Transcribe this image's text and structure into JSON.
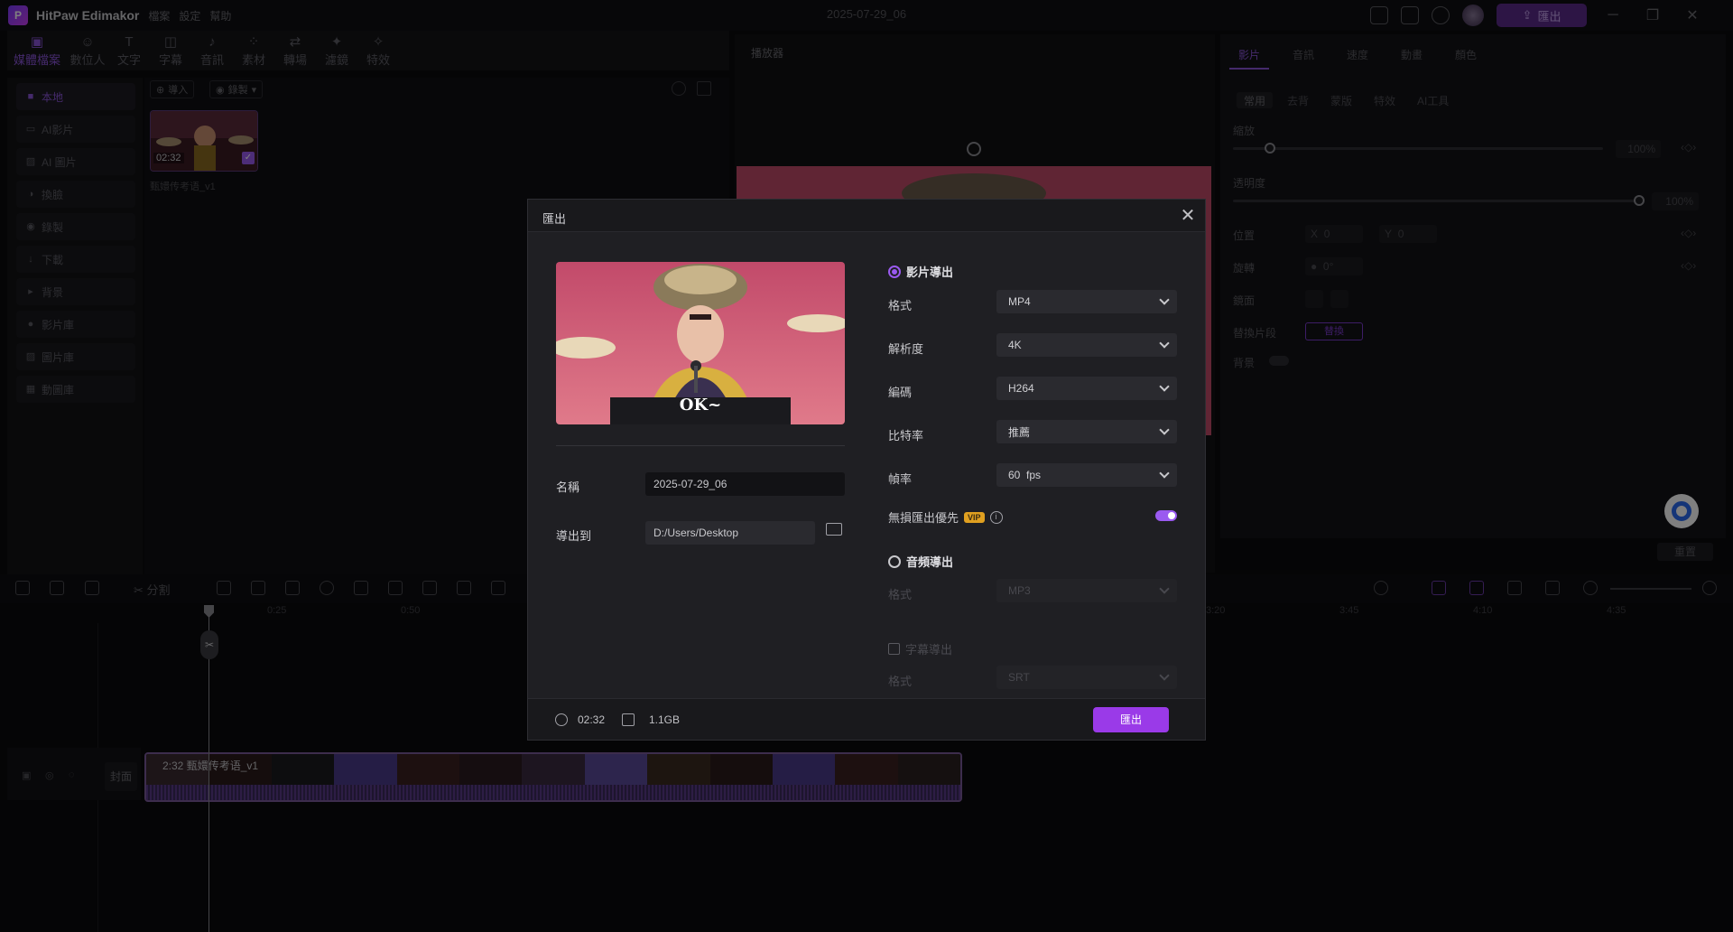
{
  "app": {
    "name": "HitPaw Edimakor",
    "window_title": "2025-07-29_06",
    "menus": [
      "檔案",
      "設定",
      "幫助"
    ],
    "top_export_label": "匯出"
  },
  "toolbar": {
    "tools": [
      "媒體檔案",
      "數位人",
      "文字",
      "字幕",
      "音訊",
      "素材",
      "轉場",
      "濾鏡",
      "特效"
    ]
  },
  "sidebar": {
    "items": [
      "本地",
      "AI影片",
      "AI 圖片",
      "換臉",
      "錄製",
      "下載",
      "背景",
      "影片庫",
      "圖片庫",
      "動圖庫"
    ]
  },
  "media": {
    "import_label": "導入",
    "record_label": "錄製",
    "clip_name": "甄嬛传考语_v1",
    "clip_duration": "02:32"
  },
  "player": {
    "title": "播放器"
  },
  "right_panel": {
    "tabs": [
      "影片",
      "音訊",
      "速度",
      "動畫",
      "顏色"
    ],
    "subtabs": [
      "常用",
      "去背",
      "蒙版",
      "特效",
      "AI工具"
    ],
    "scale_label": "縮放",
    "scale_value": "100%",
    "scale_level": 0.1,
    "opacity_label": "透明度",
    "opacity_value": "100%",
    "opacity_level": 1.0,
    "position_label": "位置",
    "pos_x_label": "X",
    "pos_x": "0",
    "pos_y_label": "Y",
    "pos_y": "0",
    "rotate_label": "旋轉",
    "rotate_value": "0°",
    "mirror_label": "鏡面",
    "replace_label": "替換片段",
    "replace_btn": "替換",
    "bg_label": "背景",
    "reset_label": "重置"
  },
  "timeline": {
    "split_label": "分割",
    "ticks": [
      "0:25",
      "0:50",
      "3:20",
      "3:45",
      "4:10",
      "4:35"
    ],
    "cover_label": "封面",
    "clip_title": "2:32 甄嬛传考语_v1"
  },
  "export_dialog": {
    "title": "匯出",
    "name_label": "名稱",
    "name_value": "2025-07-29_06",
    "export_to_label": "導出到",
    "export_to_value": "D:/Users/Desktop",
    "video_export_label": "影片導出",
    "format_label": "格式",
    "format_value": "MP4",
    "resolution_label": "解析度",
    "resolution_value": "4K",
    "codec_label": "編碼",
    "codec_value": "H264",
    "bitrate_label": "比特率",
    "bitrate_value": "推薦",
    "framerate_label": "幀率",
    "framerate_value": "60  fps",
    "lossless_label": "無損匯出優先",
    "vip_badge": "VIP",
    "lossless_enabled": true,
    "audio_export_label": "音頻導出",
    "audio_format_label": "格式",
    "audio_format_value": "MP3",
    "subtitle_export_label": "字幕導出",
    "subtitle_format_label": "格式",
    "subtitle_format_value": "SRT",
    "preview_caption": "OK~",
    "duration": "02:32",
    "size": "1.1GB",
    "export_button": "匯出"
  },
  "colors": {
    "accent": "#9a3ae8",
    "vip": "#e0a020"
  }
}
